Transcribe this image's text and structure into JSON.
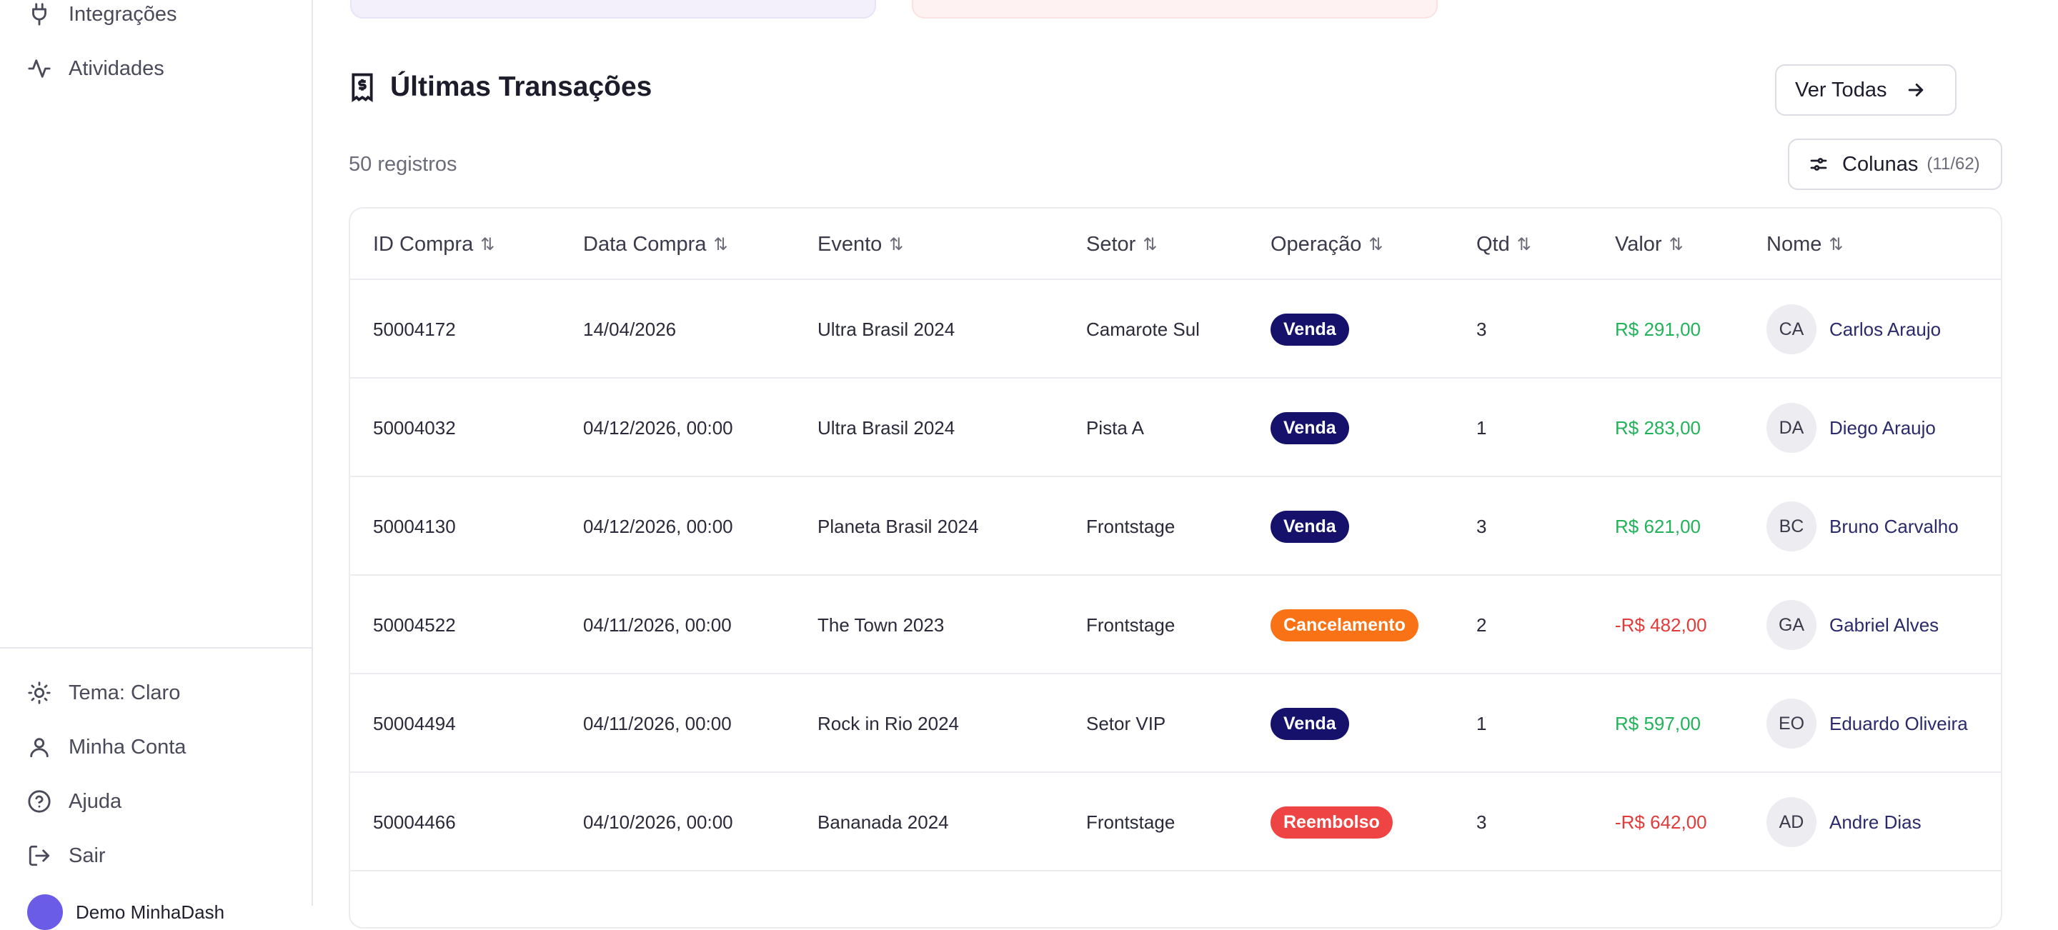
{
  "sidebar": {
    "nav": [
      {
        "label": "Integrações",
        "icon": "plug-icon"
      },
      {
        "label": "Atividades",
        "icon": "activity-icon"
      }
    ],
    "bottom": [
      {
        "label": "Tema: Claro",
        "icon": "sun-icon"
      },
      {
        "label": "Minha Conta",
        "icon": "user-icon"
      },
      {
        "label": "Ajuda",
        "icon": "help-circle-icon"
      },
      {
        "label": "Sair",
        "icon": "logout-icon"
      }
    ],
    "user_name": "Demo MinhaDash"
  },
  "section": {
    "title": "Últimas Transações",
    "view_all": "Ver Todas",
    "records": "50 registros",
    "columns_label": "Colunas",
    "columns_count": "(11/62)"
  },
  "table": {
    "headers": [
      "ID Compra",
      "Data Compra",
      "Evento",
      "Setor",
      "Operação",
      "Qtd",
      "Valor",
      "Nome"
    ],
    "sort_glyph": "⇅",
    "rows": [
      {
        "id": "50004172",
        "date": "14/04/2026",
        "event": "Ultra Brasil 2024",
        "sector": "Camarote Sul",
        "operation": "Venda",
        "qty": "3",
        "value": "R$ 291,00",
        "initials": "CA",
        "name": "Carlos Araujo"
      },
      {
        "id": "50004032",
        "date": "04/12/2026, 00:00",
        "event": "Ultra Brasil 2024",
        "sector": "Pista A",
        "operation": "Venda",
        "qty": "1",
        "value": "R$ 283,00",
        "initials": "DA",
        "name": "Diego Araujo"
      },
      {
        "id": "50004130",
        "date": "04/12/2026, 00:00",
        "event": "Planeta Brasil 2024",
        "sector": "Frontstage",
        "operation": "Venda",
        "qty": "3",
        "value": "R$ 621,00",
        "initials": "BC",
        "name": "Bruno Carvalho"
      },
      {
        "id": "50004522",
        "date": "04/11/2026, 00:00",
        "event": "The Town 2023",
        "sector": "Frontstage",
        "operation": "Cancelamento",
        "qty": "2",
        "value": "-R$ 482,00",
        "initials": "GA",
        "name": "Gabriel Alves"
      },
      {
        "id": "50004494",
        "date": "04/11/2026, 00:00",
        "event": "Rock in Rio 2024",
        "sector": "Setor VIP",
        "operation": "Venda",
        "qty": "1",
        "value": "R$ 597,00",
        "initials": "EO",
        "name": "Eduardo Oliveira"
      },
      {
        "id": "50004466",
        "date": "04/10/2026, 00:00",
        "event": "Bananada 2024",
        "sector": "Frontstage",
        "operation": "Reembolso",
        "qty": "3",
        "value": "-R$ 642,00",
        "initials": "AD",
        "name": "Andre Dias"
      }
    ]
  },
  "colors": {
    "venda": "#16126b",
    "cancelamento": "#f97316",
    "reembolso": "#ef4444",
    "positive": "#22b35a",
    "negative": "#e23b3b"
  }
}
